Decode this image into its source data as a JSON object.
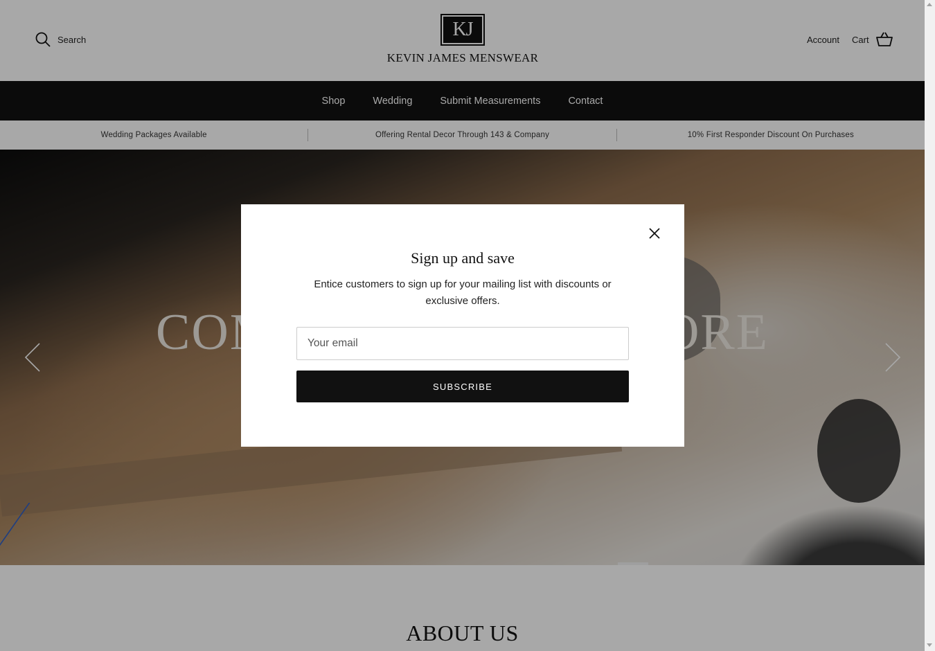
{
  "header": {
    "search_label": "Search",
    "logo_monogram": "KJ",
    "logo_text": "KEVIN JAMES MENSWEAR",
    "account_label": "Account",
    "cart_label": "Cart"
  },
  "nav": {
    "items": [
      {
        "label": "Shop"
      },
      {
        "label": "Wedding"
      },
      {
        "label": "Submit Measurements"
      },
      {
        "label": "Contact"
      }
    ]
  },
  "announcement": {
    "items": [
      {
        "text": "Wedding Packages Available"
      },
      {
        "text": "Offering Rental Decor Through 143 & Company"
      },
      {
        "text": "10% First Responder Discount On Purchases"
      }
    ]
  },
  "hero": {
    "heading": "COME VISIT OUR STORE"
  },
  "about": {
    "title": "ABOUT US"
  },
  "modal": {
    "title": "Sign up and save",
    "text": "Entice customers to sign up for your mailing list with discounts or exclusive offers.",
    "email_placeholder": "Your email",
    "subscribe_label": "SUBSCRIBE"
  },
  "colors": {
    "nav_bg": "#111111",
    "button_bg": "#111111",
    "overlay": "rgba(0,0,0,0.34)"
  }
}
